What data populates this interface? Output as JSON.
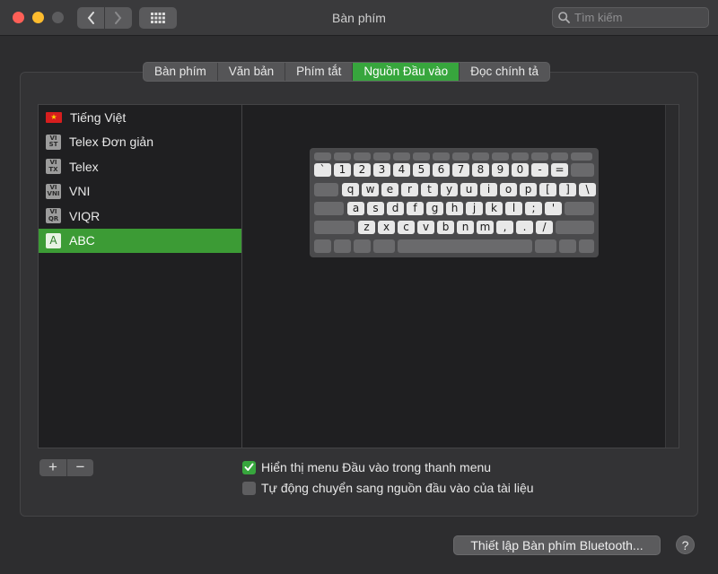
{
  "window": {
    "title": "Bàn phím"
  },
  "search": {
    "placeholder": "Tìm kiếm"
  },
  "tabs": [
    {
      "label": "Bàn phím",
      "active": false
    },
    {
      "label": "Văn bản",
      "active": false
    },
    {
      "label": "Phím tắt",
      "active": false
    },
    {
      "label": "Nguồn Đầu vào",
      "active": true
    },
    {
      "label": "Đọc chính tả",
      "active": false
    }
  ],
  "sources": [
    {
      "label": "Tiếng Việt",
      "icon": "vietnam-flag-icon",
      "badge": "★"
    },
    {
      "label": "Telex Đơn giản",
      "icon": "telex-simple-icon",
      "badge_top": "VI",
      "badge_bottom": "ST"
    },
    {
      "label": "Telex",
      "icon": "telex-icon",
      "badge_top": "VI",
      "badge_bottom": "TX"
    },
    {
      "label": "VNI",
      "icon": "vni-icon",
      "badge_top": "VI",
      "badge_bottom": "VNI"
    },
    {
      "label": "VIQR",
      "icon": "viqr-icon",
      "badge_top": "VI",
      "badge_bottom": "QR"
    },
    {
      "label": "ABC",
      "icon": "abc-letter-icon",
      "badge": "A",
      "selected": true
    }
  ],
  "keyboard": {
    "row1": [
      "`",
      "1",
      "2",
      "3",
      "4",
      "5",
      "6",
      "7",
      "8",
      "9",
      "0",
      "-",
      "="
    ],
    "row2": [
      "q",
      "w",
      "e",
      "r",
      "t",
      "y",
      "u",
      "i",
      "o",
      "p",
      "[",
      "]",
      "\\"
    ],
    "row3": [
      "a",
      "s",
      "d",
      "f",
      "g",
      "h",
      "j",
      "k",
      "l",
      ";",
      "'"
    ],
    "row4": [
      "z",
      "x",
      "c",
      "v",
      "b",
      "n",
      "m",
      ",",
      ".",
      "/"
    ]
  },
  "controls": {
    "add_label": "+",
    "remove_label": "−",
    "show_menu_label": "Hiển thị menu Đầu vào trong thanh menu",
    "show_menu_checked": true,
    "auto_switch_label": "Tự động chuyển sang nguồn đầu vào của tài liệu",
    "auto_switch_checked": false,
    "bluetooth_button": "Thiết lập Bàn phím Bluetooth...",
    "help_label": "?"
  },
  "colors": {
    "accent": "#37a63d",
    "selection": "#3c9b35",
    "background": "#2d2d2f"
  }
}
